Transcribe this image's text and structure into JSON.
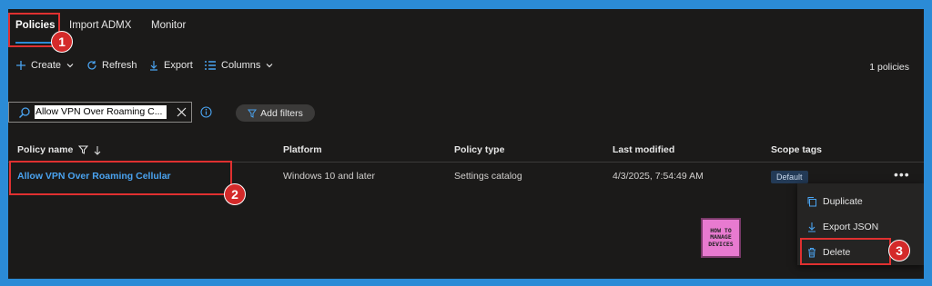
{
  "tabs": [
    {
      "label": "Policies",
      "active": true
    },
    {
      "label": "Import ADMX",
      "active": false
    },
    {
      "label": "Monitor",
      "active": false
    }
  ],
  "toolbar": {
    "create": "Create",
    "refresh": "Refresh",
    "export": "Export",
    "columns": "Columns",
    "count": "1 policies"
  },
  "search": {
    "value": "Allow VPN Over Roaming C..."
  },
  "filters": {
    "label": "Add filters"
  },
  "table": {
    "headers": [
      "Policy name",
      "Platform",
      "Policy type",
      "Last modified",
      "Scope tags"
    ],
    "row": {
      "name": "Allow VPN Over Roaming Cellular",
      "platform": "Windows 10 and later",
      "type": "Settings catalog",
      "modified": "4/3/2025, 7:54:49 AM",
      "scope": "Default"
    }
  },
  "context_menu": {
    "items": [
      {
        "label": "Duplicate",
        "icon": "copy-icon"
      },
      {
        "label": "Export JSON",
        "icon": "download-icon"
      },
      {
        "label": "Delete",
        "icon": "trash-icon"
      }
    ]
  },
  "callouts": [
    "1",
    "2",
    "3"
  ],
  "logo": {
    "lines": [
      "HOW TO",
      "MANAGE",
      "DEVICES"
    ]
  },
  "colors": {
    "accent": "#2b8bd6",
    "link": "#4aa3f0",
    "callout": "#d42a2a",
    "background": "#1b1a19"
  }
}
